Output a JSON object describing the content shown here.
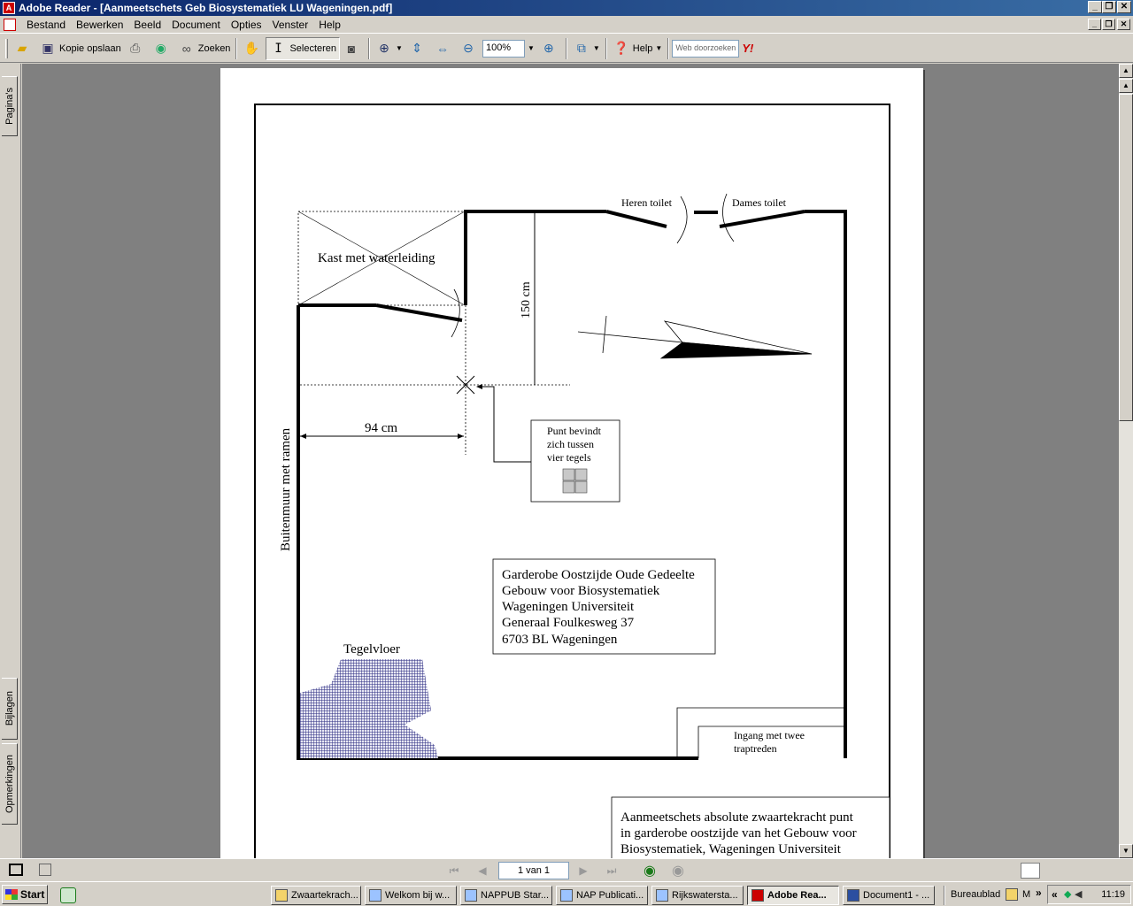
{
  "window": {
    "title": "Adobe Reader - [Aanmeetschets Geb Biosystematiek LU Wageningen.pdf]",
    "controls": [
      "_",
      "❐",
      "✕"
    ]
  },
  "menu": {
    "items": [
      "Bestand",
      "Bewerken",
      "Beeld",
      "Document",
      "Opties",
      "Venster",
      "Help"
    ]
  },
  "toolbar": {
    "save_label": "Kopie opslaan",
    "search_label": "Zoeken",
    "select_label": "Selecteren",
    "zoom_value": "100%",
    "help_label": "Help",
    "web_search_placeholder": "Web doorzoeken",
    "yahoo_label": "Y!"
  },
  "side_tabs": {
    "pages": "Pagina's",
    "attachments": "Bijlagen",
    "comments": "Opmerkingen"
  },
  "drawing": {
    "labels": {
      "men_toilet": "Heren toilet",
      "women_toilet": "Dames toilet",
      "cabinet": "Kast met waterleiding",
      "dim_150": "150 cm",
      "dim_94": "94 cm",
      "outer_wall": "Buitenmuur met ramen",
      "point_note": [
        "Punt bevindt",
        "zich tussen",
        "vier tegels"
      ],
      "address": [
        "Garderobe Oostzijde Oude Gedeelte",
        "Gebouw voor Biosystematiek",
        "Wageningen Universiteit",
        "Generaal Foulkesweg 37",
        "6703 BL Wageningen"
      ],
      "tile_floor": "Tegelvloer",
      "entrance": [
        "Ingang met twee",
        "traptreden"
      ],
      "caption": [
        "Aanmeetschets absolute zwaartekracht punt",
        "in garderobe oostzijde van het Gebouw voor",
        "Biosystematiek, Wageningen Universiteit"
      ]
    }
  },
  "status": {
    "page_indicator": "1 van 1"
  },
  "taskbar": {
    "start_label": "Start",
    "tasks": [
      "Zwaartekrach...",
      "Welkom bij w...",
      "NAPPUB Star...",
      "NAP Publicati...",
      "Rijkswatersta...",
      "Adobe Rea...",
      "Document1 - ..."
    ],
    "desktop_label": "Bureaublad",
    "tray_text": "M",
    "clock": "11:19"
  }
}
